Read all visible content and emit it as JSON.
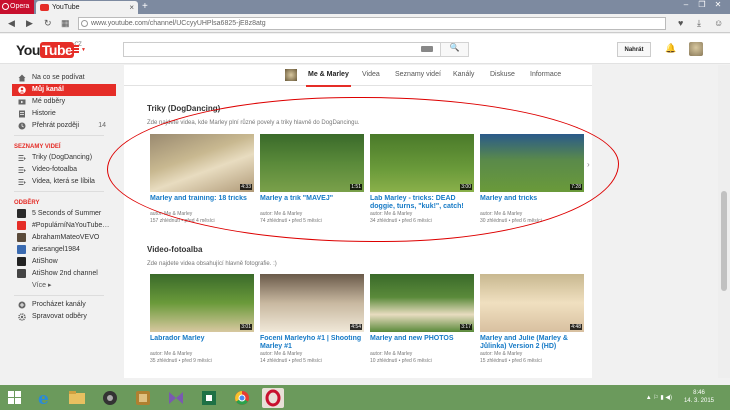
{
  "browser": {
    "menu_label": "Opera",
    "tab_title": "YouTube",
    "tab_close": "×",
    "new_tab": "+",
    "url": "www.youtube.com/channel/UCcyyUHPlsa6825-jE8z8atg",
    "win_min": "–",
    "win_max": "❐",
    "win_close": "✕",
    "back": "◀",
    "forward": "▶",
    "reload": "↻",
    "grid": "▦",
    "heart": "♥",
    "download": "⤓",
    "stash": "☺"
  },
  "header": {
    "logo_you": "You",
    "logo_tube": "Tube",
    "logo_region": "CZ",
    "search_button": "🔍",
    "upload_label": "Nahrát",
    "bell": "🔔"
  },
  "sidebar": {
    "items": [
      {
        "label": "Na co se podívat"
      },
      {
        "label": "Můj kanál"
      },
      {
        "label": "Mé odběry"
      },
      {
        "label": "Historie"
      },
      {
        "label": "Přehrát později",
        "count": "14"
      }
    ],
    "playlists_heading": "SEZNAMY VIDEÍ",
    "playlists": [
      {
        "label": "Triky (DogDancing)"
      },
      {
        "label": "Video-fotoalba"
      },
      {
        "label": "Videa, která se líbila"
      }
    ],
    "subs_heading": "ODBĚRY",
    "subs": [
      {
        "label": "5 Seconds of Summer",
        "color": "#2a2a2a"
      },
      {
        "label": "#PopulárníNaYouTube…",
        "color": "#e52d27"
      },
      {
        "label": "AbrahamMateoVEVO",
        "color": "#5a4a3a"
      },
      {
        "label": "ariesangel1984",
        "color": "#3a6ab0"
      },
      {
        "label": "AtiShow",
        "color": "#222222"
      },
      {
        "label": "AtiShow 2nd channel",
        "color": "#444444"
      }
    ],
    "more_label": "Více ▸",
    "footer": [
      {
        "label": "Procházet kanály"
      },
      {
        "label": "Spravovat odběry"
      }
    ]
  },
  "channel_tabs": [
    {
      "label": "Me & Marley",
      "selected": true
    },
    {
      "label": "Videa"
    },
    {
      "label": "Seznamy videí"
    },
    {
      "label": "Kanály"
    },
    {
      "label": "Diskuse"
    },
    {
      "label": "Informace"
    }
  ],
  "shelves": [
    {
      "title": "Triky (DogDancing)",
      "desc": "Zde najdete videa, kde Marley plní různé povely a triky hlavně do DogDancingu.",
      "videos": [
        {
          "title": "Marley and training: 18 tricks",
          "author": "autor: Me & Marley",
          "stats": "157 zhlédnutí • před 4 měsíci",
          "duration": "4:33",
          "thumb": "linear-gradient(160deg,#9a8a70 0%,#c8b890 40%,#e8dcc0 60%,#b09a78 100%)"
        },
        {
          "title": "Marley a trik \"MAVEJ\"",
          "author": "autor: Me & Marley",
          "stats": "74 zhlédnutí • před 5 měsíci",
          "duration": "1:51",
          "thumb": "linear-gradient(180deg,#3a6a2a 0%,#5a8a3a 50%,#7aa04a 100%)"
        },
        {
          "title": "Lab Marley - tricks: DEAD doggie, turns, \"kuk!\", catch!",
          "author": "autor: Me & Marley",
          "stats": "34 zhlédnutí • před 6 měsíci",
          "duration": "3:00",
          "thumb": "linear-gradient(180deg,#4a7a2a 0%,#6a9a3a 60%,#8ab04a 100%)"
        },
        {
          "title": "Marley and tricks",
          "author": "autor: Me & Marley",
          "stats": "30 zhlédnutí • před 6 měsíci",
          "duration": "7:28",
          "thumb": "linear-gradient(180deg,#2a5a8a 0%,#5a8a4a 45%,#6a9a3a 100%)"
        }
      ]
    },
    {
      "title": "Video-fotoalba",
      "desc": "Zde najdete videa obsahující hlavně fotografie. :)",
      "videos": [
        {
          "title": "Labrador Marley",
          "author": "autor: Me & Marley",
          "stats": "35 zhlédnutí • před 9 měsíci",
          "duration": "3:01",
          "thumb": "linear-gradient(180deg,#3a6a2a 0%,#6a9a3a 50%,#d8c8a0 100%)"
        },
        {
          "title": "Focení Marleyho #1 | Shooting Marley #1",
          "author": "autor: Me & Marley",
          "stats": "14 zhlédnutí • před 5 měsíci",
          "duration": "4:54",
          "thumb": "linear-gradient(180deg,#6a5a4a 0%,#c8b8a0 50%,#f0e8d8 100%)"
        },
        {
          "title": "Marley and new PHOTOS",
          "author": "autor: Me & Marley",
          "stats": "10 zhlédnutí • před 6 měsíci",
          "duration": "3:17",
          "thumb": "linear-gradient(180deg,#3a6a2a 0%,#5a8a3a 40%,#e8dcc0 70%,#5a8a3a 100%)"
        },
        {
          "title": "Marley and Julie (Marley & Jůlinka) Version 2 (HD)",
          "author": "autor: Me & Marley",
          "stats": "15 zhlédnutí • před 6 měsíci",
          "duration": "4:48",
          "thumb": "linear-gradient(180deg,#c8b890 0%,#f0e0c0 50%,#d8c0a0 100%)"
        }
      ]
    }
  ],
  "taskbar": {
    "clock_time": "8:46",
    "clock_date": "14. 3. 2015",
    "tray": "▲ ⚐ ▮ ◀)"
  },
  "colors": {
    "accent": "#e52d27",
    "link": "#167ac6",
    "annotation": "#dd0000"
  }
}
